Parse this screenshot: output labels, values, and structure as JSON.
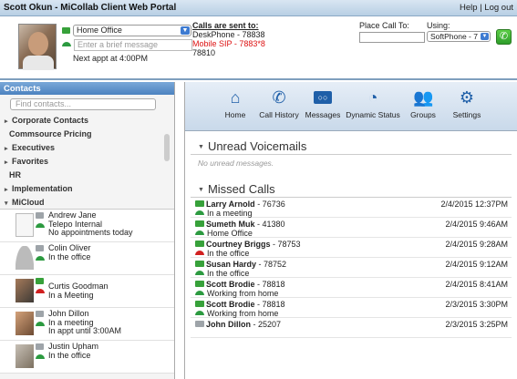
{
  "titlebar": {
    "title": "Scott Okun - MiCollab Client Web Portal",
    "links": "Help | Log out"
  },
  "header": {
    "status_value": "Home Office",
    "message_placeholder": "Enter a brief message",
    "appointment": "Next appt at 4:00PM",
    "calls_sent_heading": "Calls are sent to:",
    "calls_sent_lines": [
      "DeskPhone - 78838",
      "Mobile SIP - 7883*8",
      "78810"
    ],
    "place_call_label": "Place Call To:",
    "using_label": "Using:",
    "using_value": "SoftPhone - 7"
  },
  "contacts": {
    "heading": "Contacts",
    "find_placeholder": "Find contacts...",
    "groups": [
      {
        "label": "Corporate Contacts",
        "arrow": "▸"
      },
      {
        "label": "Commsource Pricing",
        "arrow": ""
      },
      {
        "label": "Executives",
        "arrow": "▸"
      },
      {
        "label": "Favorites",
        "arrow": "▸"
      },
      {
        "label": "HR",
        "arrow": ""
      },
      {
        "label": "Implementation",
        "arrow": "▸"
      },
      {
        "label": "MiCloud",
        "arrow": "▾"
      }
    ],
    "people": [
      {
        "line1": "Andrew Jane",
        "line2": "Telepo Internal",
        "line3": "No appointments today"
      },
      {
        "line1": "Colin Oliver",
        "line2": "In the office",
        "line3": ""
      },
      {
        "line1": "Curtis Goodman",
        "line2": "In a Meeting",
        "line3": ""
      },
      {
        "line1": "John Dillon",
        "line2": "In a meeting",
        "line3": "In appt until 3:00AM"
      },
      {
        "line1": "Justin Upham",
        "line2": "In the office",
        "line3": ""
      }
    ]
  },
  "toolbar": {
    "items": [
      "Home",
      "Call History",
      "Messages",
      "Dynamic Status",
      "Groups",
      "Settings"
    ]
  },
  "voicemail": {
    "title": "Unread Voicemails",
    "empty": "No unread messages."
  },
  "missed": {
    "title": "Missed Calls",
    "calls": [
      {
        "name": "Larry Arnold",
        "ext": " - 76736",
        "status": "In a meeting",
        "date": "2/4/2015 12:37PM"
      },
      {
        "name": "Sumeth Muk",
        "ext": " - 41380",
        "status": "Home Office",
        "date": "2/4/2015 9:46AM"
      },
      {
        "name": "Courtney Briggs",
        "ext": " - 78753",
        "status": "In the office",
        "date": "2/4/2015 9:28AM"
      },
      {
        "name": "Susan Hardy",
        "ext": " - 78752",
        "status": "In the office",
        "date": "2/4/2015 9:12AM"
      },
      {
        "name": "Scott Brodie",
        "ext": " - 78818",
        "status": "Working from home",
        "date": "2/4/2015 8:41AM"
      },
      {
        "name": "Scott Brodie",
        "ext": " - 78818",
        "status": "Working from home",
        "date": "2/3/2015 3:30PM"
      },
      {
        "name": "John Dillon",
        "ext": " - 25207",
        "status": "",
        "date": "2/3/2015 3:25PM"
      }
    ]
  }
}
